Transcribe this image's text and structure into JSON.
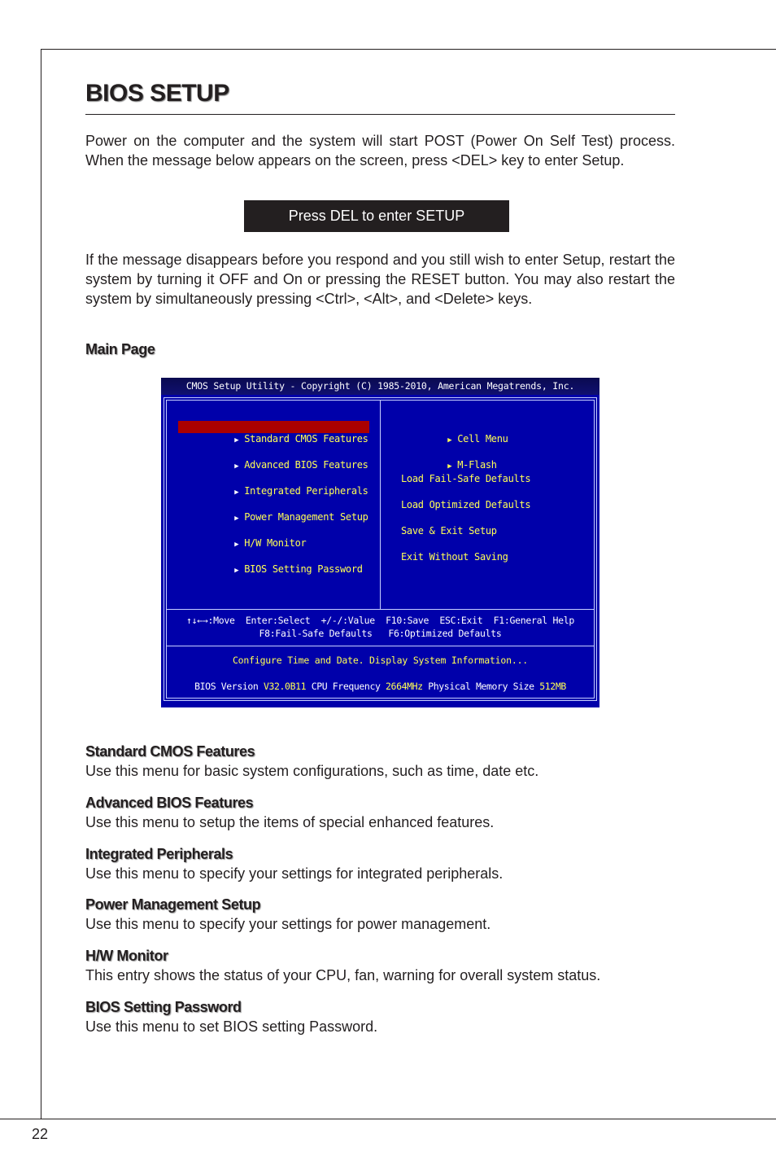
{
  "page": {
    "title": "BIOS SETUP",
    "intro": "Power on the computer and the system will start POST (Power On Self Test) process. When the message below appears on the screen, press <DEL> key to enter Setup.",
    "del_message": "Press DEL to enter SETUP",
    "restart_text": "If the message disappears before you respond and you still wish to enter Setup, restart the system by turning it OFF and On or pressing the RESET button. You may also restart the system by simultaneously pressing <Ctrl>, <Alt>, and <Delete> keys.",
    "main_page_heading": "Main Page",
    "page_number": "22"
  },
  "bios": {
    "title_bar": "CMOS Setup Utility - Copyright (C) 1985-2010, American Megatrends, Inc.",
    "colors": {
      "background": "#0000aa",
      "highlight": "#aa0000",
      "text": "#ffff55",
      "label": "#ffffff"
    },
    "left_menu": [
      {
        "label": "Standard CMOS Features",
        "submenu": true,
        "selected": true
      },
      {
        "label": "Advanced BIOS Features",
        "submenu": true,
        "selected": false
      },
      {
        "label": "Integrated Peripherals",
        "submenu": true,
        "selected": false
      },
      {
        "label": "Power Management Setup",
        "submenu": true,
        "selected": false
      },
      {
        "label": "H/W Monitor",
        "submenu": true,
        "selected": false
      },
      {
        "label": "BIOS Setting Password",
        "submenu": true,
        "selected": false
      }
    ],
    "right_menu": [
      {
        "label": "Cell Menu",
        "submenu": true
      },
      {
        "label": "M-Flash",
        "submenu": true
      },
      {
        "label": "Load Fail-Safe Defaults",
        "submenu": false
      },
      {
        "label": "Load Optimized Defaults",
        "submenu": false
      },
      {
        "label": "Save & Exit Setup",
        "submenu": false
      },
      {
        "label": "Exit Without Saving",
        "submenu": false
      }
    ],
    "help_line_1": "↑↓←→:Move  Enter:Select  +/-/:Value  F10:Save  ESC:Exit  F1:General Help",
    "help_line_2": "F8:Fail-Safe Defaults   F6:Optimized Defaults",
    "description": "Configure Time and Date.  Display System Information...",
    "status": {
      "bios_version_label": "BIOS Version",
      "bios_version": "V32.0B11",
      "cpu_frequency_label": "CPU Frequency",
      "cpu_frequency": "2664MHz",
      "memory_label": "Physical Memory Size",
      "memory": "512MB"
    },
    "arrow_icon": "▶"
  },
  "sections": [
    {
      "title": "Standard CMOS Features",
      "desc": "Use this menu for basic system configurations, such as time, date etc."
    },
    {
      "title": "Advanced BIOS Features",
      "desc": "Use this menu to setup the items of special enhanced features."
    },
    {
      "title": "Integrated Peripherals",
      "desc": "Use this menu to specify your settings for integrated peripherals."
    },
    {
      "title": "Power Management Setup",
      "desc": "Use this menu to specify your settings for power management."
    },
    {
      "title": "H/W Monitor",
      "desc": "This entry shows the status of your CPU, fan, warning for overall system status."
    },
    {
      "title": "BIOS Setting Password",
      "desc": "Use this menu to set BIOS setting Password."
    }
  ]
}
